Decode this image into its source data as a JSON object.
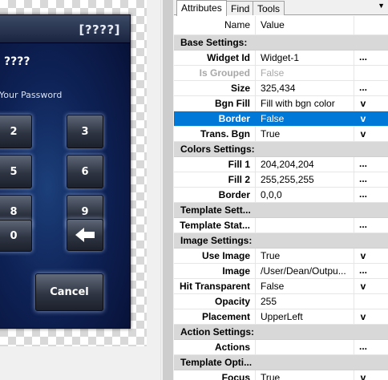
{
  "device": {
    "title": "[????]",
    "heading": "????",
    "prompt": "Your Password",
    "keys": [
      "2",
      "3",
      "5",
      "6",
      "8",
      "9",
      "0"
    ],
    "cancel_label": "Cancel"
  },
  "panel": {
    "tabs": [
      "Attributes",
      "Find",
      "Tools"
    ],
    "header": {
      "name": "Name",
      "value": "Value"
    },
    "rows": [
      {
        "category": "Base Settings:"
      },
      {
        "name": "Widget Id",
        "value": "Widget-1",
        "button": "..."
      },
      {
        "name": "Is Grouped",
        "value": "False",
        "disabled": true
      },
      {
        "name": "Size",
        "value": "325,434",
        "button": "..."
      },
      {
        "name": "Bgn Fill",
        "value": "Fill with bgn color",
        "button": "v"
      },
      {
        "name": "Border",
        "value": "False",
        "button": "v",
        "selected": true
      },
      {
        "name": "Trans. Bgn",
        "value": "True",
        "button": "v"
      },
      {
        "category": "Colors Settings:"
      },
      {
        "name": "Fill 1",
        "value": "204,204,204",
        "button": "..."
      },
      {
        "name": "Fill 2",
        "value": "255,255,255",
        "button": "..."
      },
      {
        "name": "Border",
        "value": "0,0,0",
        "button": "..."
      },
      {
        "category": "Template Sett..."
      },
      {
        "name": "Template Stat...",
        "value": "",
        "button": "..."
      },
      {
        "category": "Image Settings:"
      },
      {
        "name": "Use Image",
        "value": "True",
        "button": "v"
      },
      {
        "name": "Image",
        "value": "/User/Dean/Outpu...",
        "button": "..."
      },
      {
        "name": "Hit Transparent",
        "value": "False",
        "button": "v"
      },
      {
        "name": "Opacity",
        "value": "255",
        "button": ""
      },
      {
        "name": "Placement",
        "value": "UpperLeft",
        "button": "v"
      },
      {
        "category": "Action Settings:"
      },
      {
        "name": "Actions",
        "value": "",
        "button": "..."
      },
      {
        "category": "Template Opti..."
      },
      {
        "name": "Focus",
        "value": "True",
        "button": "v"
      }
    ]
  },
  "icons": {
    "back_key": "arrow-left-icon",
    "tab_menu": "dropdown-triangle-icon"
  },
  "colors": {
    "selected_row": "#0078d7",
    "category_row": "#d8d8d8",
    "device_bg": "#0e2256"
  }
}
